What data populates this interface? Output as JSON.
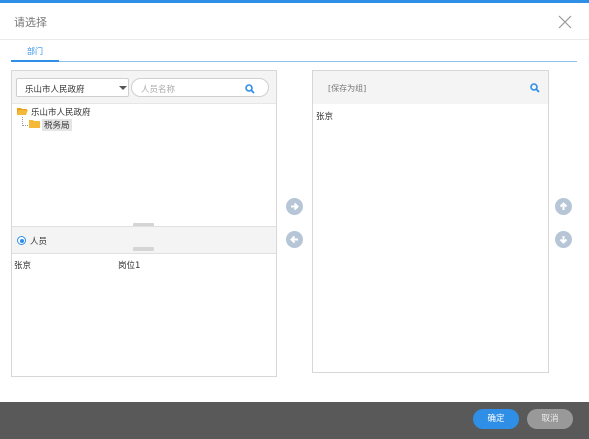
{
  "dialog": {
    "title": "请选择"
  },
  "tabs": [
    {
      "label": "部门"
    }
  ],
  "left": {
    "dept_select": "乐山市人民政府",
    "search_placeholder": "人员名称",
    "tree": [
      {
        "label": "乐山市人民政府"
      },
      {
        "label": "税务局"
      }
    ],
    "person_radio_label": "人员",
    "persons": [
      {
        "name": "张京",
        "position": "岗位1"
      }
    ]
  },
  "right": {
    "header_label": "[保存为组]",
    "items": [
      "张京"
    ]
  },
  "footer": {
    "ok_label": "确定",
    "cancel_label": "取消"
  },
  "colors": {
    "accent": "#2f8fe6",
    "footer_bg": "#595959",
    "arrow_button": "#b6c6d6",
    "cancel_button": "#999999"
  },
  "icons": [
    "close-icon",
    "chevron-down-icon",
    "search-icon",
    "folder-open-icon",
    "folder-icon",
    "arrow-right-icon",
    "arrow-left-icon",
    "arrow-up-icon",
    "arrow-down-icon"
  ]
}
